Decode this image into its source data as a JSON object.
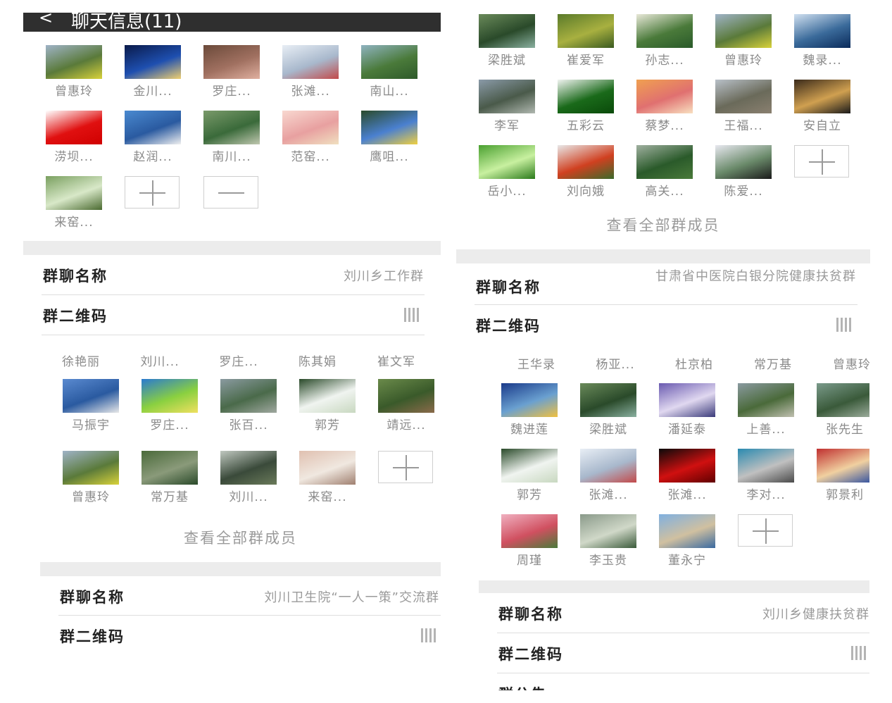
{
  "panel1": {
    "header": {
      "back_icon": "chevron-left",
      "title": "聊天信息(11)"
    },
    "members": [
      {
        "name": "曾惠玲",
        "photo": [
          "#9fb3c7",
          "#5a7a3a",
          "#d8d23a"
        ]
      },
      {
        "name": "金川...",
        "photo": [
          "#0a1a4a",
          "#1e4fb0",
          "#f0d070"
        ]
      },
      {
        "name": "罗庄...",
        "photo": [
          "#6b4a3a",
          "#a07060",
          "#e0b0a0"
        ]
      },
      {
        "name": "张滩...",
        "photo": [
          "#e8eef5",
          "#a8b8cc",
          "#c24a4a"
        ]
      },
      {
        "name": "南山...",
        "photo": [
          "#8fb3c0",
          "#4a7a3a",
          "#2e5a2a"
        ]
      },
      {
        "name": "涝坝...",
        "photo": [
          "#ffffff",
          "#e01010",
          "#d00000"
        ]
      },
      {
        "name": "赵润...",
        "photo": [
          "#4a8ad0",
          "#2a5aa0",
          "#f0f0f0"
        ]
      },
      {
        "name": "南川...",
        "photo": [
          "#7a9a6a",
          "#3a6a3a",
          "#c0c8b0"
        ]
      },
      {
        "name": "范窑...",
        "photo": [
          "#f8d8d0",
          "#e8a0a0",
          "#f0e0c0"
        ]
      },
      {
        "name": "鹰咀...",
        "photo": [
          "#2a4a2a",
          "#4a80d0",
          "#f0d040"
        ]
      },
      {
        "name": "来窑...",
        "photo": [
          "#7aa060",
          "#d8e8c8",
          "#4a6a30"
        ]
      }
    ],
    "group_name_label": "群聊名称",
    "group_name_value": "刘川乡工作群",
    "qr_label": "群二维码"
  },
  "panel2": {
    "members": [
      {
        "name": "梁胜斌",
        "photo": [
          "#6a8a5a",
          "#2a4a2a",
          "#8ab0a0"
        ]
      },
      {
        "name": "崔爱军",
        "photo": [
          "#5a7a2a",
          "#a8b040",
          "#3a5a20"
        ]
      },
      {
        "name": "孙志...",
        "photo": [
          "#e8e8d8",
          "#4a7a3a",
          "#2a5a2a"
        ]
      },
      {
        "name": "曾惠玲",
        "photo": [
          "#9fb3c7",
          "#5a7a3a",
          "#d8d23a"
        ]
      },
      {
        "name": "魏录...",
        "photo": [
          "#d0e0f0",
          "#3a6a9a",
          "#0a2a5a"
        ]
      },
      {
        "name": "李军",
        "photo": [
          "#8a9aa8",
          "#4a5a4a",
          "#b0b8b0"
        ]
      },
      {
        "name": "五彩云",
        "photo": [
          "#f0f4f0",
          "#1a6a1a",
          "#0a4a0a"
        ]
      },
      {
        "name": "蔡梦...",
        "photo": [
          "#f0a050",
          "#e07070",
          "#f8e0c0"
        ]
      },
      {
        "name": "王福...",
        "photo": [
          "#b8c0c8",
          "#6a6a5a",
          "#8a8070"
        ]
      },
      {
        "name": "安自立",
        "photo": [
          "#3a2a1a",
          "#d0a050",
          "#1a1a1a"
        ]
      },
      {
        "name": "岳小...",
        "photo": [
          "#4aa030",
          "#c8f0a0",
          "#2a7a1a"
        ]
      },
      {
        "name": "刘向娥",
        "photo": [
          "#e8e8e8",
          "#d04020",
          "#3a6a2a"
        ]
      },
      {
        "name": "高关...",
        "photo": [
          "#a0b0a0",
          "#2a5a2a",
          "#4a7a3a"
        ]
      },
      {
        "name": "陈爱...",
        "photo": [
          "#e8e8f0",
          "#6a8a6a",
          "#1a1a1a"
        ]
      }
    ],
    "view_all": "查看全部群成员",
    "group_name_label": "群聊名称",
    "group_name_value": "甘肃省中医院白银分院健康扶贫群",
    "qr_label": "群二维码"
  },
  "panel3": {
    "clipped_names": [
      "徐艳丽",
      "刘川...",
      "罗庄...",
      "陈其娟",
      "崔文军"
    ],
    "members": [
      {
        "name": "马振宇",
        "photo": [
          "#5a8ad0",
          "#2a5aa0",
          "#e8e8e8"
        ]
      },
      {
        "name": "罗庄...",
        "photo": [
          "#2a7ad0",
          "#8ad040",
          "#f0e060"
        ]
      },
      {
        "name": "张百...",
        "photo": [
          "#8a9aa0",
          "#4a6a4a",
          "#a0a8a0"
        ]
      },
      {
        "name": "郭芳",
        "photo": [
          "#2a4a2a",
          "#f0f4f0",
          "#c8d8c0"
        ]
      },
      {
        "name": "靖远...",
        "photo": [
          "#6a8a4a",
          "#3a5a2a",
          "#8a6a4a"
        ]
      },
      {
        "name": "曾惠玲",
        "photo": [
          "#9fb3c7",
          "#5a7a3a",
          "#d8d23a"
        ]
      },
      {
        "name": "常万基",
        "photo": [
          "#4a6a3a",
          "#8a9a7a",
          "#2a4a2a"
        ]
      },
      {
        "name": "刘川...",
        "photo": [
          "#c0c8c0",
          "#3a4a3a",
          "#6a7a5a"
        ]
      },
      {
        "name": "来窑...",
        "photo": [
          "#e0c0b0",
          "#f0e8e0",
          "#a08070"
        ]
      }
    ],
    "view_all": "查看全部群成员",
    "group_name_label": "群聊名称",
    "group_name_value": "刘川卫生院“一人一策”交流群",
    "qr_label": "群二维码"
  },
  "panel4": {
    "clipped_names": [
      "王华录",
      "杨亚...",
      "杜京柏",
      "常万基",
      "曾惠玲"
    ],
    "members": [
      {
        "name": "魏进莲",
        "photo": [
          "#1a3a8a",
          "#6aa0d0",
          "#f0c040"
        ]
      },
      {
        "name": "梁胜斌",
        "photo": [
          "#6a8a5a",
          "#2a4a2a",
          "#8ab0a0"
        ]
      },
      {
        "name": "潘延泰",
        "photo": [
          "#6a5ab0",
          "#e0d8f0",
          "#3a3a7a"
        ]
      },
      {
        "name": "上善...",
        "photo": [
          "#8a9aa0",
          "#4a6a3a",
          "#c0c0b0"
        ]
      },
      {
        "name": "张先生",
        "photo": [
          "#7a9a8a",
          "#3a5a3a",
          "#a0b0a0"
        ]
      },
      {
        "name": "郭芳",
        "photo": [
          "#2a4a2a",
          "#f0f4f0",
          "#c8d8c0"
        ]
      },
      {
        "name": "张滩...",
        "photo": [
          "#e8eef5",
          "#a8b8cc",
          "#c24a4a"
        ]
      },
      {
        "name": "张滩...",
        "photo": [
          "#0a0a0a",
          "#d01010",
          "#600000"
        ]
      },
      {
        "name": "李对...",
        "photo": [
          "#2a8ab0",
          "#c0c0c0",
          "#4a4a4a"
        ]
      },
      {
        "name": "郭景利",
        "photo": [
          "#c03030",
          "#f0d0a0",
          "#3050a0"
        ]
      },
      {
        "name": "周瑾",
        "photo": [
          "#f0b0c0",
          "#d05060",
          "#4a7a3a"
        ]
      },
      {
        "name": "李玉贵",
        "photo": [
          "#8a9a8a",
          "#d0d8c8",
          "#3a5a3a"
        ]
      },
      {
        "name": "董永宁",
        "photo": [
          "#80b0e0",
          "#d0c0a0",
          "#3a6aa0"
        ]
      }
    ],
    "group_name_label": "群聊名称",
    "group_name_value": "刘川乡健康扶贫群",
    "qr_label": "群二维码",
    "clipped_row_label": "群公告"
  }
}
